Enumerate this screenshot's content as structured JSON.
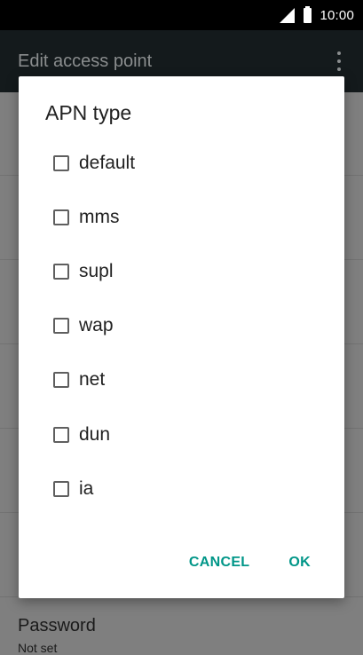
{
  "status_bar": {
    "time": "10:00",
    "icons": [
      "signal-icon",
      "battery-icon"
    ]
  },
  "app_bar": {
    "title": "Edit access point",
    "menu_icon": "more-vert-icon"
  },
  "background_list": {
    "visible_row_label": "Password",
    "visible_row_value": "Not set"
  },
  "dialog": {
    "title": "APN type",
    "options": [
      {
        "label": "default",
        "checked": false
      },
      {
        "label": "mms",
        "checked": false
      },
      {
        "label": "supl",
        "checked": false
      },
      {
        "label": "wap",
        "checked": false
      },
      {
        "label": "net",
        "checked": false
      },
      {
        "label": "dun",
        "checked": false
      },
      {
        "label": "ia",
        "checked": false
      }
    ],
    "cancel_label": "CANCEL",
    "ok_label": "OK"
  },
  "colors": {
    "accent": "#009688",
    "dialog_bg": "#ffffff",
    "scrim": "#7f7f7f",
    "status_bar": "#000000"
  }
}
